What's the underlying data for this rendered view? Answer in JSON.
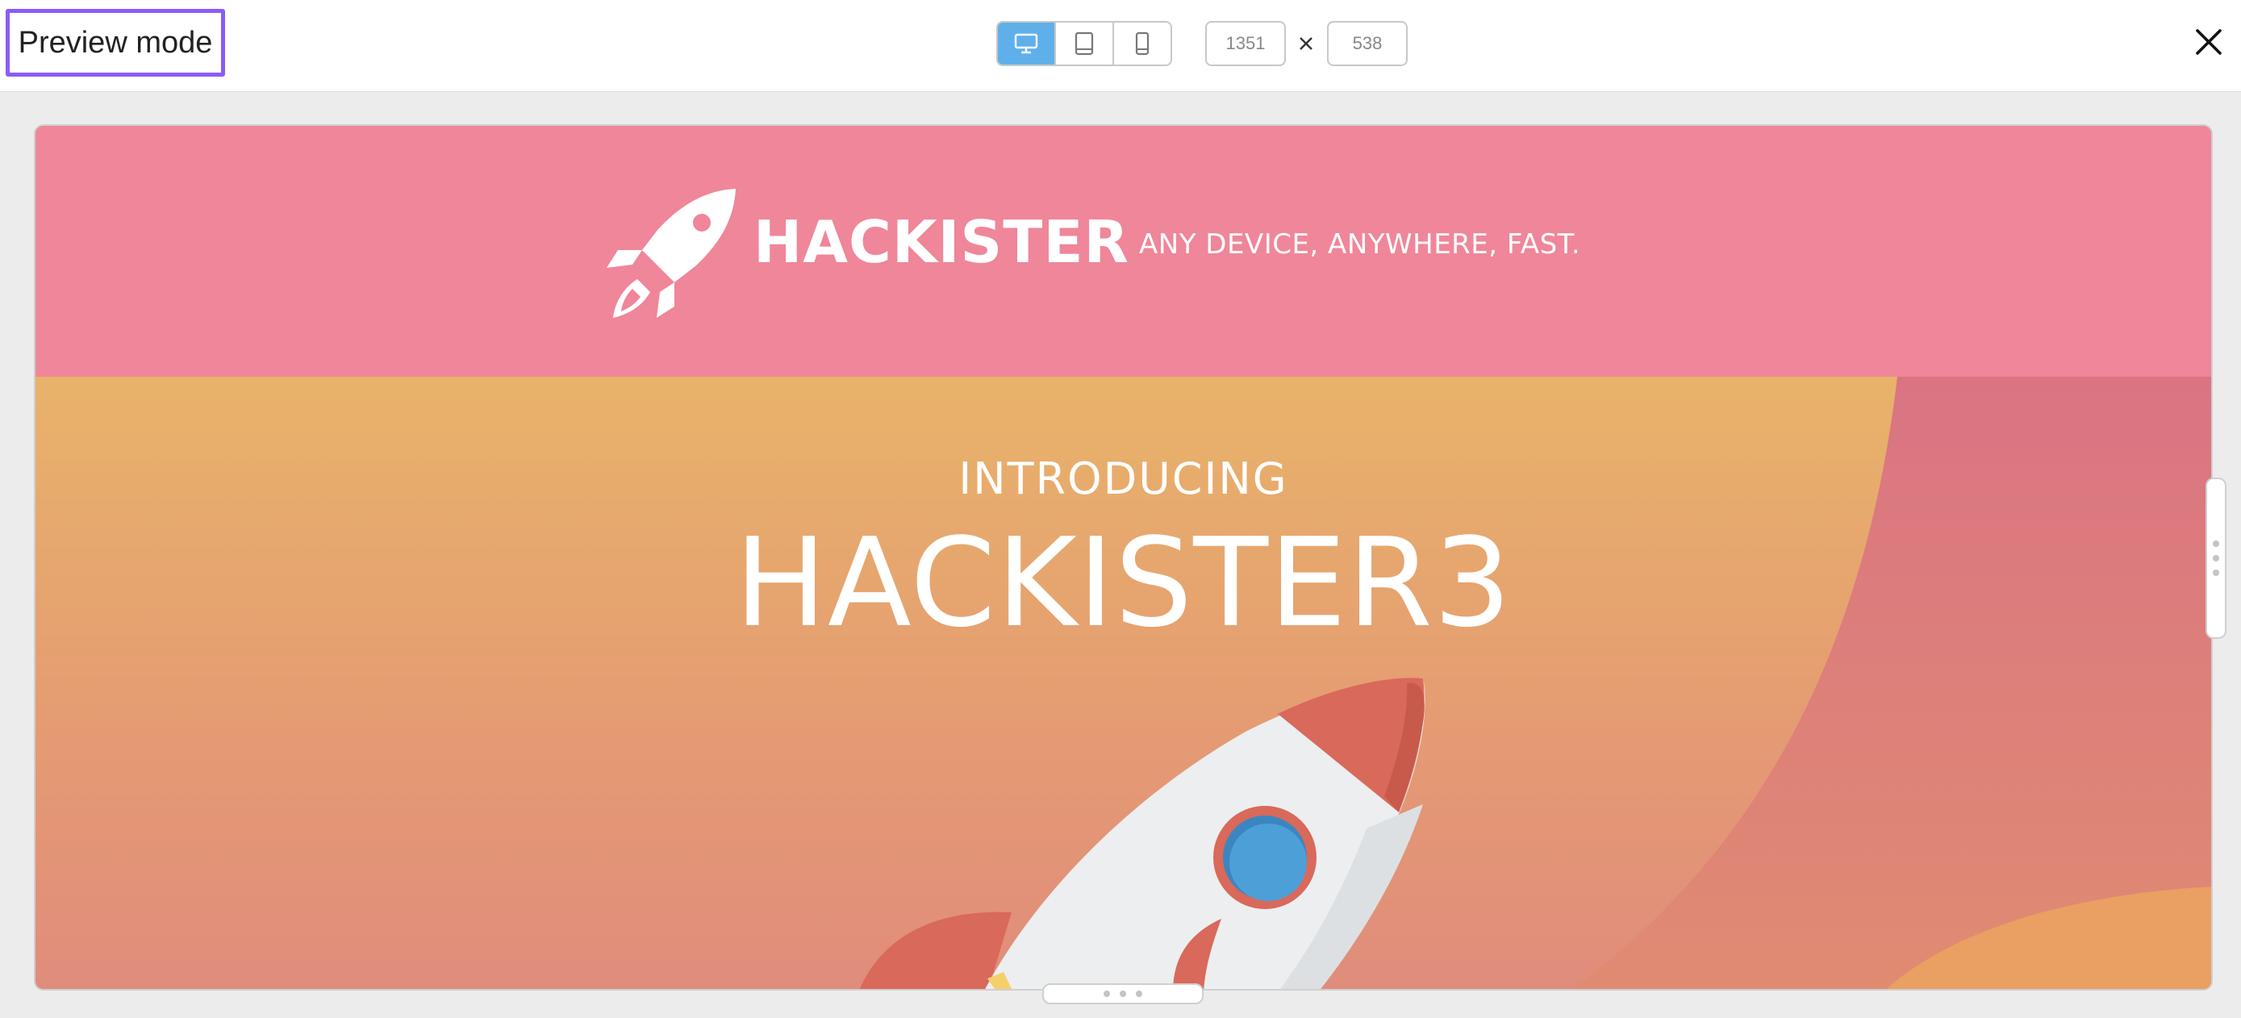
{
  "toolbar": {
    "title": "Preview mode",
    "devices": [
      {
        "name": "desktop",
        "icon": "desktop-icon",
        "active": true
      },
      {
        "name": "tablet",
        "icon": "tablet-icon",
        "active": false
      },
      {
        "name": "mobile",
        "icon": "mobile-icon",
        "active": false
      }
    ],
    "width_value": "1351",
    "height_value": "538",
    "times_icon": "times-icon",
    "close_icon": "close-icon"
  },
  "preview": {
    "header": {
      "brand": "HACKISTER",
      "tagline": "ANY DEVICE, ANYWHERE, FAST.",
      "logo_icon": "rocket-icon"
    },
    "hero": {
      "intro": "INTRODUCING",
      "title": "HACKISTER3"
    }
  },
  "colors": {
    "accent_active": "#5fb0ea",
    "focus_outline": "#8b5cf6",
    "header_pink": "#ef8699",
    "hero_orange": "#e8b36a",
    "rocket_red": "#d9695a",
    "window_blue": "#4d9fd8"
  }
}
